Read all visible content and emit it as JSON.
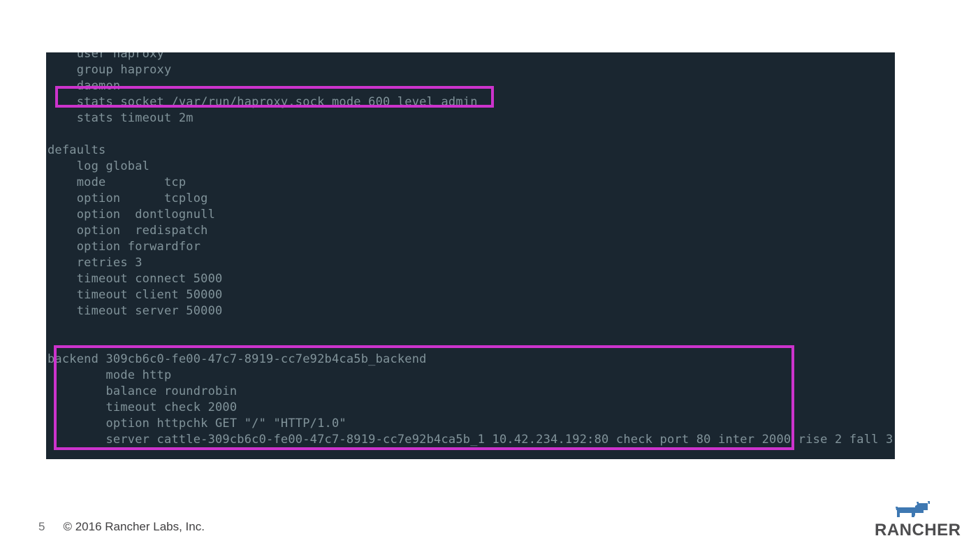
{
  "page": {
    "background_color": "#ffffff",
    "slide_number": "5",
    "copyright": "© 2016 Rancher Labs, Inc."
  },
  "brand": {
    "name": "RANCHER",
    "logo_icon": "rancher-cow-icon",
    "logo_color": "#3e78b2",
    "wordmark_color": "#4d4d4f"
  },
  "terminal": {
    "background_color": "#1a2630",
    "text_color": "#81939a",
    "highlight_color": "#cc33cc",
    "lines": [
      "    user haproxy",
      "    group haproxy",
      "    daemon",
      "    stats socket /var/run/haproxy.sock mode 600 level admin",
      "    stats timeout 2m",
      "",
      "defaults",
      "    log global",
      "    mode        tcp",
      "    option      tcplog",
      "    option  dontlognull",
      "    option  redispatch",
      "    option forwardfor",
      "    retries 3",
      "    timeout connect 5000",
      "    timeout client 50000",
      "    timeout server 50000",
      "",
      "",
      "backend 309cb6c0-fe00-47c7-8919-cc7e92b4ca5b_backend",
      "        mode http",
      "        balance roundrobin",
      "        timeout check 2000",
      "        option httpchk GET \"/\" \"HTTP/1.0\"",
      "        server cattle-309cb6c0-fe00-47c7-8919-cc7e92b4ca5b_1 10.42.234.192:80 check port 80 inter 2000 rise 2 fall 3"
    ],
    "highlights": [
      {
        "name": "stats-socket-line",
        "text": "stats socket /var/run/haproxy.sock mode 600 level admin"
      },
      {
        "name": "backend-block",
        "text": "backend 309cb6c0-fe00-47c7-8919-cc7e92b4ca5b_backend"
      }
    ]
  }
}
